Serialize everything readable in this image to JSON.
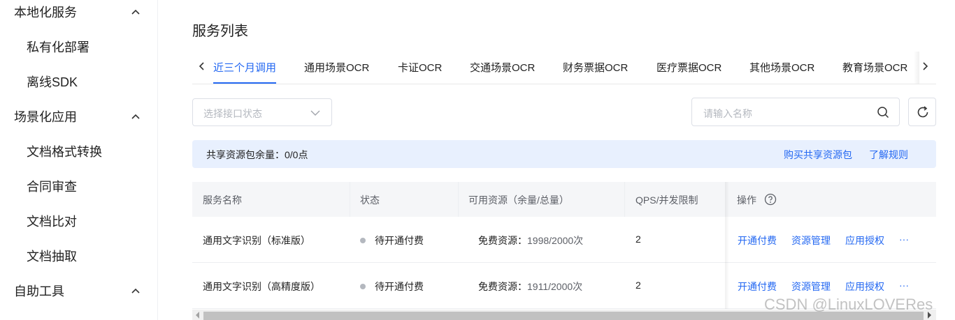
{
  "sidebar": {
    "groups": [
      {
        "label": "本地化服务",
        "items": [
          "私有化部署",
          "离线SDK"
        ]
      },
      {
        "label": "场景化应用",
        "items": [
          "文档格式转换",
          "合同审查",
          "文档比对",
          "文档抽取"
        ]
      },
      {
        "label": "自助工具",
        "items": []
      }
    ]
  },
  "main": {
    "title": "服务列表",
    "tabs": [
      "近三个月调用",
      "通用场景OCR",
      "卡证OCR",
      "交通场景OCR",
      "财务票据OCR",
      "医疗票据OCR",
      "其他场景OCR",
      "教育场景OCR"
    ],
    "active_tab": "近三个月调用",
    "status_select_placeholder": "选择接口状态",
    "search_placeholder": "请输入名称",
    "notice": {
      "text": "共享资源包余量：0/0点",
      "buy_link": "购买共享资源包",
      "rules_link": "了解规则"
    },
    "table": {
      "columns": [
        "服务名称",
        "状态",
        "可用资源（余量/总量）",
        "QPS/并发限制",
        "操作"
      ],
      "rows": [
        {
          "name": "通用文字识别（标准版）",
          "status": "待开通付费",
          "resource_label": "免费资源：",
          "resource_value": "1998/2000次",
          "qps": "2"
        },
        {
          "name": "通用文字识别（高精度版）",
          "status": "待开通付费",
          "resource_label": "免费资源：",
          "resource_value": "1911/2000次",
          "qps": "2"
        }
      ],
      "actions": [
        "开通付费",
        "资源管理",
        "应用授权",
        "···"
      ]
    }
  },
  "watermark": "CSDN @LinuxLOVERes",
  "colors": {
    "accent": "#2468f2",
    "notice_bg": "#e8f0fe",
    "header_bg": "#f5f6f8"
  }
}
